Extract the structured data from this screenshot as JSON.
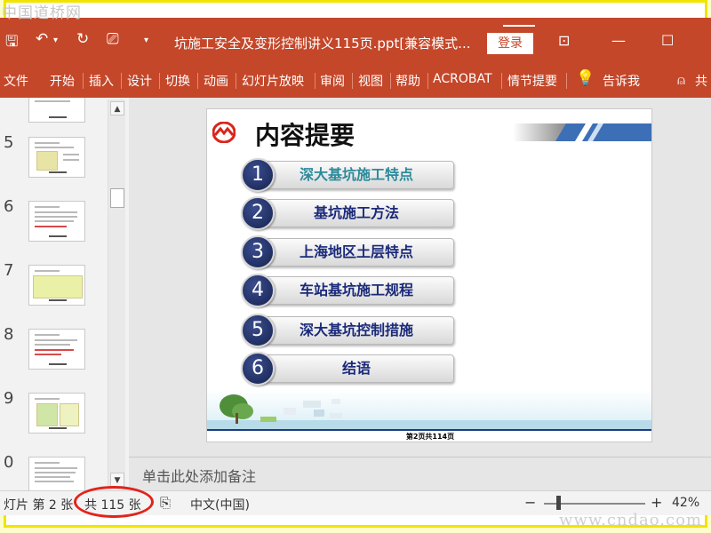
{
  "watermark_top": "中国道桥网",
  "watermark_bottom": "www.cndao.com",
  "titlebar": {
    "title": "坑施工安全及变形控制讲义115页.ppt[兼容模式...",
    "login": "登录"
  },
  "menu": [
    "文件",
    "开始",
    "插入",
    "设计",
    "切换",
    "动画",
    "幻灯片放映",
    "审阅",
    "视图",
    "帮助",
    "ACROBAT",
    "情节提要",
    "告诉我",
    "共"
  ],
  "thumbnails": [
    {
      "num": "5"
    },
    {
      "num": "6"
    },
    {
      "num": "7"
    },
    {
      "num": "8"
    },
    {
      "num": "9"
    },
    {
      "num": "0"
    }
  ],
  "slide": {
    "title": "内容提要",
    "items": [
      {
        "num": "1",
        "label": "深大基坑施工特点"
      },
      {
        "num": "2",
        "label": "基坑施工方法"
      },
      {
        "num": "3",
        "label": "上海地区土层特点"
      },
      {
        "num": "4",
        "label": "车站基坑施工规程"
      },
      {
        "num": "5",
        "label": "深大基坑控制措施"
      },
      {
        "num": "6",
        "label": "结语"
      }
    ],
    "footer": "第2页共114页"
  },
  "notes": {
    "placeholder": "单击此处添加备注"
  },
  "status": {
    "slide_pos": "灯片 第 2 张",
    "total": "共 115 张",
    "language": "中文(中国)",
    "zoom_minus": "−",
    "zoom_plus": "+",
    "zoom": "42%"
  },
  "colors": {
    "ribbon": "#c4472a",
    "highlight": "#e2231a",
    "item_text": "#1b2a7a"
  }
}
